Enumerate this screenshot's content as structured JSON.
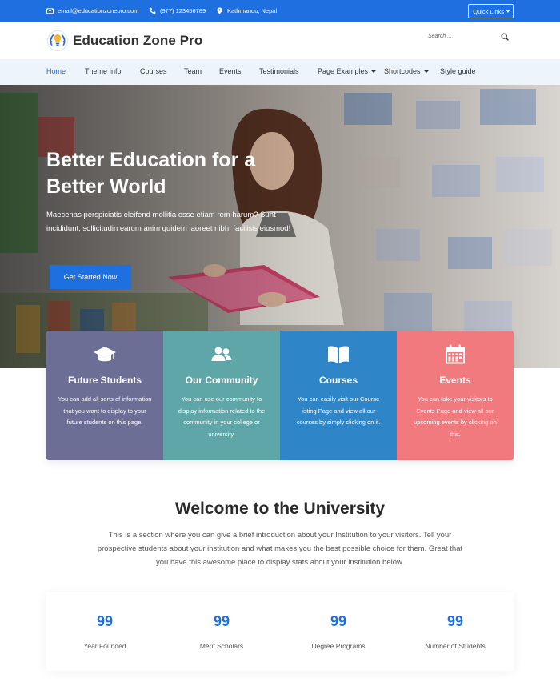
{
  "topbar": {
    "email": "email@educationzonepro.com",
    "phone": "(977) 123456789",
    "location": "Kathmandu, Nepal",
    "quick_links": "Quick Links"
  },
  "header": {
    "brand": "Education Zone Pro",
    "search_placeholder": "Search ..."
  },
  "nav": {
    "items": [
      {
        "label": "Home",
        "active": true
      },
      {
        "label": "Theme Info"
      },
      {
        "label": "Courses"
      },
      {
        "label": "Team"
      },
      {
        "label": "Events"
      },
      {
        "label": "Testimonials"
      },
      {
        "label": "Page Examples",
        "dropdown": true
      },
      {
        "label": "Shortcodes",
        "dropdown": true
      },
      {
        "label": "Style guide"
      }
    ]
  },
  "hero": {
    "title": "Better Education for a Better World",
    "text": "Maecenas perspiciatis eleifend mollitia esse etiam rem harum? Sunt incididunt, sollicitudin earum anim quidem laoreet nibh, facilisis eiusmod!",
    "button": "Get Started Now"
  },
  "cards": [
    {
      "title": "Future Students",
      "text": "You can add all sorts of information that you want to display to your future students on this page.",
      "icon": "graduation-cap-icon",
      "color": "#6c6e96"
    },
    {
      "title": "Our Community",
      "text": "You can use our community to display information related to the community in your college or university.",
      "icon": "users-icon",
      "color": "#5fa6a8"
    },
    {
      "title": "Courses",
      "text": "You can easily visit our Course listing Page and view all our courses by simply clicking on it.",
      "icon": "book-icon",
      "color": "#2e86c9"
    },
    {
      "title": "Events",
      "text": "You can take your visitors to Events Page and view all our upcoming events by clicking on this.",
      "icon": "calendar-icon",
      "color": "#f07a7e"
    }
  ],
  "welcome": {
    "title": "Welcome to the University",
    "text": "This is a section where you can give a brief introduction about your Institution to your visitors. Tell your prospective students about your institution and what makes you the best possible choice for them. Great that you have this awesome place to display stats about your institution below."
  },
  "stats": [
    {
      "value": "99",
      "label": "Year Founded"
    },
    {
      "value": "99",
      "label": "Merit Scholars"
    },
    {
      "value": "99",
      "label": "Degree Programs"
    },
    {
      "value": "99",
      "label": "Number of Students"
    }
  ],
  "colors": {
    "primary": "#1e6fe0",
    "nav_bg": "#eef4fb"
  }
}
